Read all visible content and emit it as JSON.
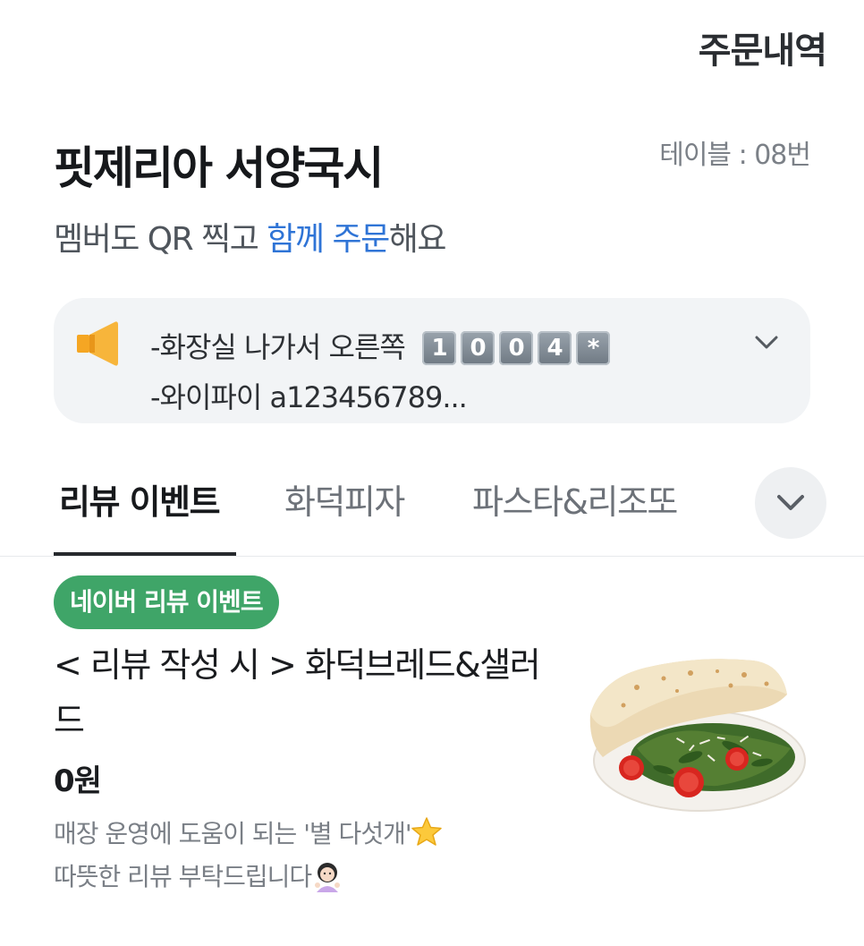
{
  "header": {
    "order_history": "주문내역"
  },
  "store": {
    "name": "핏제리아 서양국시",
    "table": "테이블 : 08번"
  },
  "subtitle": {
    "prefix": "멤버도 QR 찍고 ",
    "highlight": "함께 주문",
    "suffix": "해요"
  },
  "notice": {
    "line1": "-화장실 나가서 오른쪽",
    "keycaps": [
      "1",
      "0",
      "0",
      "4",
      "*"
    ],
    "line2": "-와이파이 a123456789..."
  },
  "tabs": [
    {
      "label": "리뷰 이벤트",
      "active": true
    },
    {
      "label": "화덕피자",
      "active": false
    },
    {
      "label": "파스타&리조또",
      "active": false
    }
  ],
  "menu_item": {
    "badge": "네이버 리뷰 이벤트",
    "title": "< 리뷰 작성 시 > 화덕브레드&샐러드",
    "price": "0원",
    "desc_line1": "매장 운영에 도움이 되는 '별 다섯개'",
    "desc_line2": "따뜻한 리뷰 부탁드립니다"
  },
  "icons": {
    "notice": "speaker-icon",
    "expand": "chevron-down-icon",
    "star": "star-emoji-icon",
    "person": "girl-emoji-icon"
  },
  "colors": {
    "accent_blue": "#2f74d6",
    "badge_green": "#3fa568",
    "notice_bg": "#f2f4f6",
    "speaker_orange": "#f5a623"
  }
}
